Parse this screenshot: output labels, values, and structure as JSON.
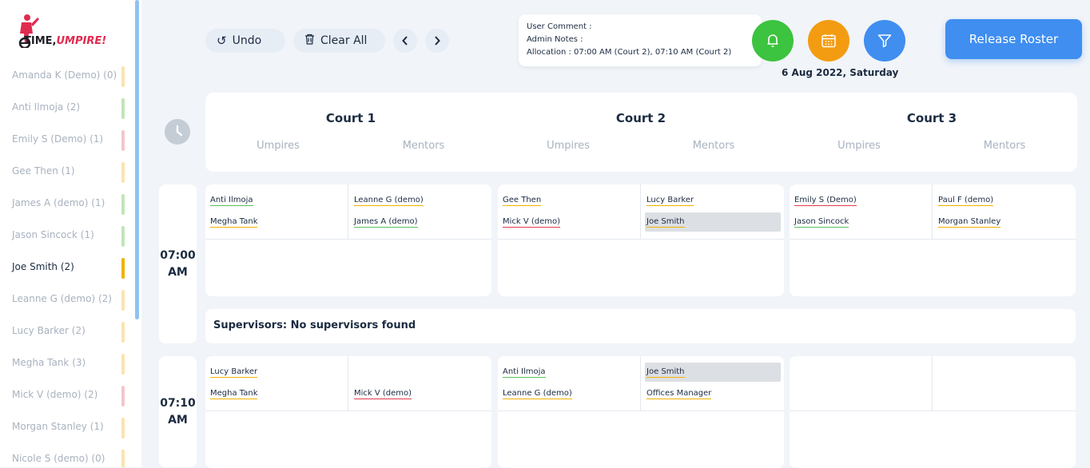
{
  "app": {
    "logo_text": "TIME,",
    "logo_text_accent": "UMPIRE!"
  },
  "sidebar": {
    "players": [
      {
        "label": "Amanda K (Demo) (0)",
        "bar": "#fbe3b0",
        "active": false
      },
      {
        "label": "Anti Ilmoja (2)",
        "bar": "#bfe6b8",
        "active": false
      },
      {
        "label": "Emily S (Demo) (1)",
        "bar": "#f3c6cc",
        "active": false
      },
      {
        "label": "Gee Then (1)",
        "bar": "#fbe3b0",
        "active": false
      },
      {
        "label": "James A (demo) (1)",
        "bar": "#bfe6b8",
        "active": false
      },
      {
        "label": "Jason Sincock (1)",
        "bar": "#bfe6b8",
        "active": false
      },
      {
        "label": "Joe Smith (2)",
        "bar": "#f2b200",
        "active": true
      },
      {
        "label": "Leanne G (demo) (2)",
        "bar": "#fbe3b0",
        "active": false
      },
      {
        "label": "Lucy Barker (2)",
        "bar": "#fbe3b0",
        "active": false
      },
      {
        "label": "Megha Tank (3)",
        "bar": "#fbe3b0",
        "active": false
      },
      {
        "label": "Mick V (demo) (2)",
        "bar": "#f3c6cc",
        "active": false
      },
      {
        "label": "Morgan Stanley (1)",
        "bar": "#fbe3b0",
        "active": false
      },
      {
        "label": "Nicole S (demo) (0)",
        "bar": "#fbe3b0",
        "active": false
      }
    ]
  },
  "toolbar": {
    "undo_label": "Undo",
    "clear_label": "Clear All",
    "prev_icon": "chevron-left-icon",
    "next_icon": "chevron-right-icon"
  },
  "comment": {
    "user_comment": "User Comment :",
    "admin_notes": "Admin Notes :",
    "allocation": "Allocation : 07:00 AM (Court 2), 07:10 AM (Court 2)"
  },
  "actions": {
    "bell_color": "#3cc33f",
    "calendar_color": "#f39c12",
    "filter_color": "#3f8ef0",
    "date": "6 Aug 2022, Saturday",
    "release_label": "Release Roster"
  },
  "courts": [
    {
      "title": "Court 1",
      "umpires": "Umpires",
      "mentors": "Mentors"
    },
    {
      "title": "Court 2",
      "umpires": "Umpires",
      "mentors": "Mentors"
    },
    {
      "title": "Court 3",
      "umpires": "Umpires",
      "mentors": "Mentors"
    }
  ],
  "slots": [
    {
      "time_line1": "07:00",
      "time_line2": "AM",
      "courts": [
        {
          "umpires": [
            {
              "name": "Anti Ilmoja",
              "color": "#5cbf5a",
              "hl": false
            },
            {
              "name": "Megha Tank",
              "color": "#f2b200",
              "hl": false
            }
          ],
          "mentors": [
            {
              "name": "Leanne G (demo)",
              "color": "#f2b200",
              "hl": false
            },
            {
              "name": "James A (demo)",
              "color": "#5cbf5a",
              "hl": false
            }
          ]
        },
        {
          "umpires": [
            {
              "name": "Gee Then",
              "color": "#f2b200",
              "hl": false
            },
            {
              "name": "Mick V (demo)",
              "color": "#e03c4c",
              "hl": false
            }
          ],
          "mentors": [
            {
              "name": "Lucy Barker",
              "color": "#f2b200",
              "hl": false
            },
            {
              "name": "Joe Smith",
              "color": "#f2b200",
              "hl": true
            }
          ]
        },
        {
          "umpires": [
            {
              "name": "Emily S (Demo)",
              "color": "#e03c4c",
              "hl": false
            },
            {
              "name": "Jason Sincock",
              "color": "#5cbf5a",
              "hl": false
            }
          ],
          "mentors": [
            {
              "name": "Paul F (demo)",
              "color": "#f2b200",
              "hl": false
            },
            {
              "name": "Morgan Stanley",
              "color": "#f2b200",
              "hl": false
            }
          ]
        }
      ],
      "supervisors": "Supervisors: No supervisors found"
    },
    {
      "time_line1": "07:10",
      "time_line2": "AM",
      "courts": [
        {
          "umpires": [
            {
              "name": "Lucy Barker",
              "color": "#f2b200",
              "hl": false
            },
            {
              "name": "Megha Tank",
              "color": "#f2b200",
              "hl": false
            }
          ],
          "mentors": [
            {
              "name": "",
              "color": "#ffffff",
              "hl": false
            },
            {
              "name": "Mick V (demo)",
              "color": "#e03c4c",
              "hl": false
            }
          ]
        },
        {
          "umpires": [
            {
              "name": "Anti Ilmoja",
              "color": "#5cbf5a",
              "hl": false
            },
            {
              "name": "Leanne G (demo)",
              "color": "#f2b200",
              "hl": false
            }
          ],
          "mentors": [
            {
              "name": "Joe Smith",
              "color": "#f2b200",
              "hl": true
            },
            {
              "name": "Offices Manager",
              "color": "#f2b200",
              "hl": false
            }
          ]
        },
        {
          "umpires": [
            {
              "name": "",
              "color": "#ffffff",
              "hl": false
            },
            {
              "name": "",
              "color": "#ffffff",
              "hl": false
            }
          ],
          "mentors": [
            {
              "name": "",
              "color": "#ffffff",
              "hl": false
            },
            {
              "name": "",
              "color": "#ffffff",
              "hl": false
            }
          ]
        }
      ]
    }
  ]
}
